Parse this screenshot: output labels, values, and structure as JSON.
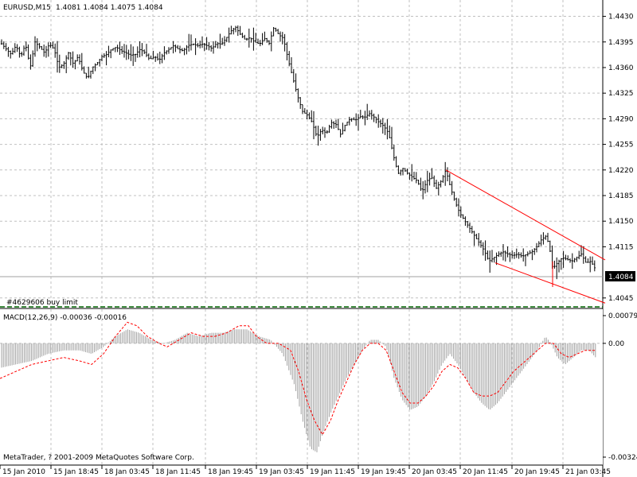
{
  "chart_data": [
    {
      "type": "candlestick",
      "header": {
        "symbol": "EURUSD,M15",
        "ohlc": "1.4081 1.4084 1.4075 1.4084"
      },
      "price_axis": {
        "ylim": [
          1.4035,
          1.4448
        ],
        "ticks": [
          "1.4430",
          "1.4395",
          "1.4360",
          "1.4325",
          "1.4290",
          "1.4255",
          "1.4220",
          "1.4185",
          "1.4150",
          "1.4115",
          "1.4045"
        ],
        "current_price": "1.4084",
        "grid": true
      },
      "series": [
        {
          "name": "EURUSD close",
          "points": [
            [
              0,
              1.4395
            ],
            [
              8,
              1.4385
            ],
            [
              14,
              1.4378
            ],
            [
              20,
              1.439
            ],
            [
              26,
              1.4375
            ],
            [
              32,
              1.4392
            ],
            [
              38,
              1.436
            ],
            [
              44,
              1.4395
            ],
            [
              50,
              1.4388
            ],
            [
              56,
              1.438
            ],
            [
              62,
              1.4392
            ],
            [
              68,
              1.4385
            ],
            [
              74,
              1.436
            ],
            [
              80,
              1.4365
            ],
            [
              86,
              1.438
            ],
            [
              92,
              1.4365
            ],
            [
              98,
              1.4375
            ],
            [
              104,
              1.4355
            ],
            [
              110,
              1.4345
            ],
            [
              116,
              1.436
            ],
            [
              122,
              1.4366
            ],
            [
              128,
              1.4375
            ],
            [
              134,
              1.4378
            ],
            [
              140,
              1.4385
            ],
            [
              146,
              1.4388
            ],
            [
              152,
              1.4383
            ],
            [
              158,
              1.438
            ],
            [
              164,
              1.4377
            ],
            [
              170,
              1.4378
            ],
            [
              176,
              1.4385
            ],
            [
              182,
              1.438
            ],
            [
              188,
              1.4371
            ],
            [
              194,
              1.4375
            ],
            [
              200,
              1.437
            ],
            [
              206,
              1.438
            ],
            [
              212,
              1.4385
            ],
            [
              218,
              1.439
            ],
            [
              224,
              1.4385
            ],
            [
              230,
              1.4383
            ],
            [
              236,
              1.439
            ],
            [
              242,
              1.4392
            ],
            [
              248,
              1.439
            ],
            [
              254,
              1.4392
            ],
            [
              260,
              1.439
            ],
            [
              266,
              1.4386
            ],
            [
              272,
              1.4393
            ],
            [
              278,
              1.4392
            ],
            [
              284,
              1.44
            ],
            [
              290,
              1.441
            ],
            [
              296,
              1.4415
            ],
            [
              302,
              1.4405
            ],
            [
              308,
              1.4398
            ],
            [
              314,
              1.4401
            ],
            [
              320,
              1.4395
            ],
            [
              326,
              1.4392
            ],
            [
              332,
              1.44
            ],
            [
              338,
              1.4393
            ],
            [
              344,
              1.4415
            ],
            [
              350,
              1.4405
            ],
            [
              356,
              1.44
            ],
            [
              362,
              1.437
            ],
            [
              368,
              1.4345
            ],
            [
              374,
              1.432
            ],
            [
              380,
              1.43
            ],
            [
              386,
              1.4295
            ],
            [
              392,
              1.4285
            ],
            [
              398,
              1.4265
            ],
            [
              404,
              1.4275
            ],
            [
              410,
              1.427
            ],
            [
              416,
              1.4285
            ],
            [
              422,
              1.4282
            ],
            [
              428,
              1.4268
            ],
            [
              434,
              1.4283
            ],
            [
              440,
              1.429
            ],
            [
              446,
              1.4288
            ],
            [
              452,
              1.4293
            ],
            [
              458,
              1.4292
            ],
            [
              464,
              1.4297
            ],
            [
              470,
              1.4292
            ],
            [
              476,
              1.4285
            ],
            [
              482,
              1.428
            ],
            [
              488,
              1.427
            ],
            [
              494,
              1.424
            ],
            [
              500,
              1.4215
            ],
            [
              506,
              1.4222
            ],
            [
              512,
              1.4215
            ],
            [
              518,
              1.421
            ],
            [
              524,
              1.4205
            ],
            [
              530,
              1.419
            ],
            [
              536,
              1.4205
            ],
            [
              542,
              1.421
            ],
            [
              548,
              1.4195
            ],
            [
              554,
              1.4205
            ],
            [
              560,
              1.422
            ],
            [
              566,
              1.4195
            ],
            [
              572,
              1.4175
            ],
            [
              578,
              1.416
            ],
            [
              584,
              1.415
            ],
            [
              590,
              1.414
            ],
            [
              596,
              1.413
            ],
            [
              602,
              1.412
            ],
            [
              608,
              1.411
            ],
            [
              614,
              1.4095
            ],
            [
              620,
              1.41
            ],
            [
              626,
              1.4105
            ],
            [
              632,
              1.4108
            ],
            [
              638,
              1.4105
            ],
            [
              644,
              1.4103
            ],
            [
              650,
              1.4105
            ],
            [
              656,
              1.4102
            ],
            [
              662,
              1.4105
            ],
            [
              668,
              1.4108
            ],
            [
              674,
              1.4115
            ],
            [
              680,
              1.4125
            ],
            [
              686,
              1.413
            ],
            [
              690,
              1.4115
            ],
            [
              694,
              1.4085
            ],
            [
              700,
              1.4093
            ],
            [
              706,
              1.41
            ],
            [
              712,
              1.4098
            ],
            [
              718,
              1.4095
            ],
            [
              724,
              1.41
            ],
            [
              730,
              1.4105
            ],
            [
              736,
              1.4093
            ],
            [
              742,
              1.4095
            ],
            [
              748,
              1.4084
            ]
          ]
        }
      ],
      "pending_order": "#4629606 buy limit",
      "trendlines": [
        {
          "color": "#ff0000",
          "from": [
            560,
            1.422
          ],
          "to": [
            760,
            1.4097
          ]
        },
        {
          "color": "#ff0000",
          "from": [
            622,
            1.4093
          ],
          "to": [
            760,
            1.4038
          ]
        },
        {
          "color": "#ff0000",
          "from": [
            694,
            1.4095
          ],
          "to": [
            694,
            1.406
          ]
        }
      ],
      "colors": {
        "candles": "#000000",
        "trendline": "#ff0000",
        "grid": "#c0c0c0",
        "order_line": "#008000"
      }
    },
    {
      "type": "histogram+line",
      "label": "MACD(12,26,9) -0.00036 -0.00016",
      "ylim": [
        -0.00324,
        0.00079
      ],
      "ticks": [
        "0.00079",
        "0.00",
        "-0.00324"
      ],
      "histogram": [
        [
          0,
          -0.0007
        ],
        [
          20,
          -0.0006
        ],
        [
          40,
          -0.0005
        ],
        [
          60,
          -0.0003
        ],
        [
          80,
          -0.0002
        ],
        [
          100,
          -0.0002
        ],
        [
          115,
          -0.0003
        ],
        [
          130,
          -0.0001
        ],
        [
          145,
          0.0002
        ],
        [
          160,
          0.0004
        ],
        [
          175,
          0.0003
        ],
        [
          190,
          0.0001
        ],
        [
          205,
          0.0
        ],
        [
          220,
          0.0001
        ],
        [
          235,
          0.0003
        ],
        [
          250,
          0.0002
        ],
        [
          265,
          0.0003
        ],
        [
          280,
          0.0003
        ],
        [
          295,
          0.0004
        ],
        [
          310,
          0.0004
        ],
        [
          325,
          0.0002
        ],
        [
          340,
          0.0001
        ],
        [
          355,
          -0.0003
        ],
        [
          370,
          -0.0012
        ],
        [
          380,
          -0.0022
        ],
        [
          390,
          -0.003
        ],
        [
          398,
          -0.0031
        ],
        [
          405,
          -0.0026
        ],
        [
          415,
          -0.002
        ],
        [
          425,
          -0.0015
        ],
        [
          435,
          -0.001
        ],
        [
          445,
          -0.0006
        ],
        [
          455,
          -0.0002
        ],
        [
          465,
          0.0001
        ],
        [
          475,
          0.0001
        ],
        [
          485,
          -0.0001
        ],
        [
          495,
          -0.001
        ],
        [
          505,
          -0.0016
        ],
        [
          515,
          -0.0019
        ],
        [
          525,
          -0.0018
        ],
        [
          535,
          -0.0015
        ],
        [
          545,
          -0.0011
        ],
        [
          555,
          -0.0006
        ],
        [
          565,
          -0.0003
        ],
        [
          575,
          -0.0006
        ],
        [
          585,
          -0.001
        ],
        [
          595,
          -0.0014
        ],
        [
          605,
          -0.0017
        ],
        [
          615,
          -0.0019
        ],
        [
          625,
          -0.0017
        ],
        [
          635,
          -0.0014
        ],
        [
          645,
          -0.0011
        ],
        [
          655,
          -0.0008
        ],
        [
          665,
          -0.0005
        ],
        [
          675,
          -0.0002
        ],
        [
          685,
          0.0002
        ],
        [
          692,
          0.0
        ],
        [
          700,
          -0.0004
        ],
        [
          710,
          -0.0006
        ],
        [
          720,
          -0.0004
        ],
        [
          730,
          -0.0002
        ],
        [
          740,
          -0.0002
        ],
        [
          748,
          -0.0004
        ]
      ],
      "signal": [
        [
          0,
          -0.001
        ],
        [
          20,
          -0.0008
        ],
        [
          40,
          -0.0006
        ],
        [
          60,
          -0.0005
        ],
        [
          80,
          -0.0004
        ],
        [
          100,
          -0.0005
        ],
        [
          115,
          -0.0006
        ],
        [
          130,
          -0.0003
        ],
        [
          145,
          0.0002
        ],
        [
          160,
          0.0006
        ],
        [
          172,
          0.0005
        ],
        [
          185,
          0.0002
        ],
        [
          200,
          0.0
        ],
        [
          210,
          -0.0001
        ],
        [
          225,
          0.0001
        ],
        [
          240,
          0.0003
        ],
        [
          255,
          0.0002
        ],
        [
          270,
          0.0002
        ],
        [
          285,
          0.0003
        ],
        [
          300,
          0.0005
        ],
        [
          312,
          0.0005
        ],
        [
          322,
          0.0002
        ],
        [
          335,
          0.0
        ],
        [
          350,
          0.0
        ],
        [
          365,
          -0.0002
        ],
        [
          375,
          -0.0008
        ],
        [
          385,
          -0.0016
        ],
        [
          395,
          -0.0022
        ],
        [
          405,
          -0.0026
        ],
        [
          415,
          -0.0022
        ],
        [
          425,
          -0.0016
        ],
        [
          435,
          -0.0011
        ],
        [
          445,
          -0.0006
        ],
        [
          455,
          -0.0002
        ],
        [
          465,
          0.0
        ],
        [
          475,
          0.0
        ],
        [
          485,
          -0.0002
        ],
        [
          495,
          -0.0008
        ],
        [
          505,
          -0.0014
        ],
        [
          515,
          -0.0017
        ],
        [
          525,
          -0.0017
        ],
        [
          535,
          -0.0015
        ],
        [
          545,
          -0.0012
        ],
        [
          555,
          -0.0008
        ],
        [
          565,
          -0.0006
        ],
        [
          575,
          -0.0007
        ],
        [
          585,
          -0.001
        ],
        [
          595,
          -0.0014
        ],
        [
          605,
          -0.0015
        ],
        [
          615,
          -0.0015
        ],
        [
          625,
          -0.0014
        ],
        [
          635,
          -0.0011
        ],
        [
          645,
          -0.0008
        ],
        [
          655,
          -0.0006
        ],
        [
          665,
          -0.0004
        ],
        [
          675,
          -0.0002
        ],
        [
          685,
          0.0
        ],
        [
          695,
          0.0
        ],
        [
          705,
          -0.0003
        ],
        [
          715,
          -0.0004
        ],
        [
          725,
          -0.0003
        ],
        [
          735,
          -0.0002
        ],
        [
          748,
          -0.0002
        ]
      ],
      "colors": {
        "histogram": "#a0a0a0",
        "signal": "#ff0000"
      }
    }
  ],
  "time_axis": [
    "15 Jan 2010",
    "15 Jan 18:45",
    "18 Jan 03:45",
    "18 Jan 11:45",
    "18 Jan 19:45",
    "19 Jan 03:45",
    "19 Jan 11:45",
    "19 Jan 19:45",
    "20 Jan 03:45",
    "20 Jan 11:45",
    "20 Jan 19:45",
    "21 Jan 03:45"
  ],
  "copyright": "MetaTrader, ? 2001-2009 MetaQuotes Software Corp."
}
